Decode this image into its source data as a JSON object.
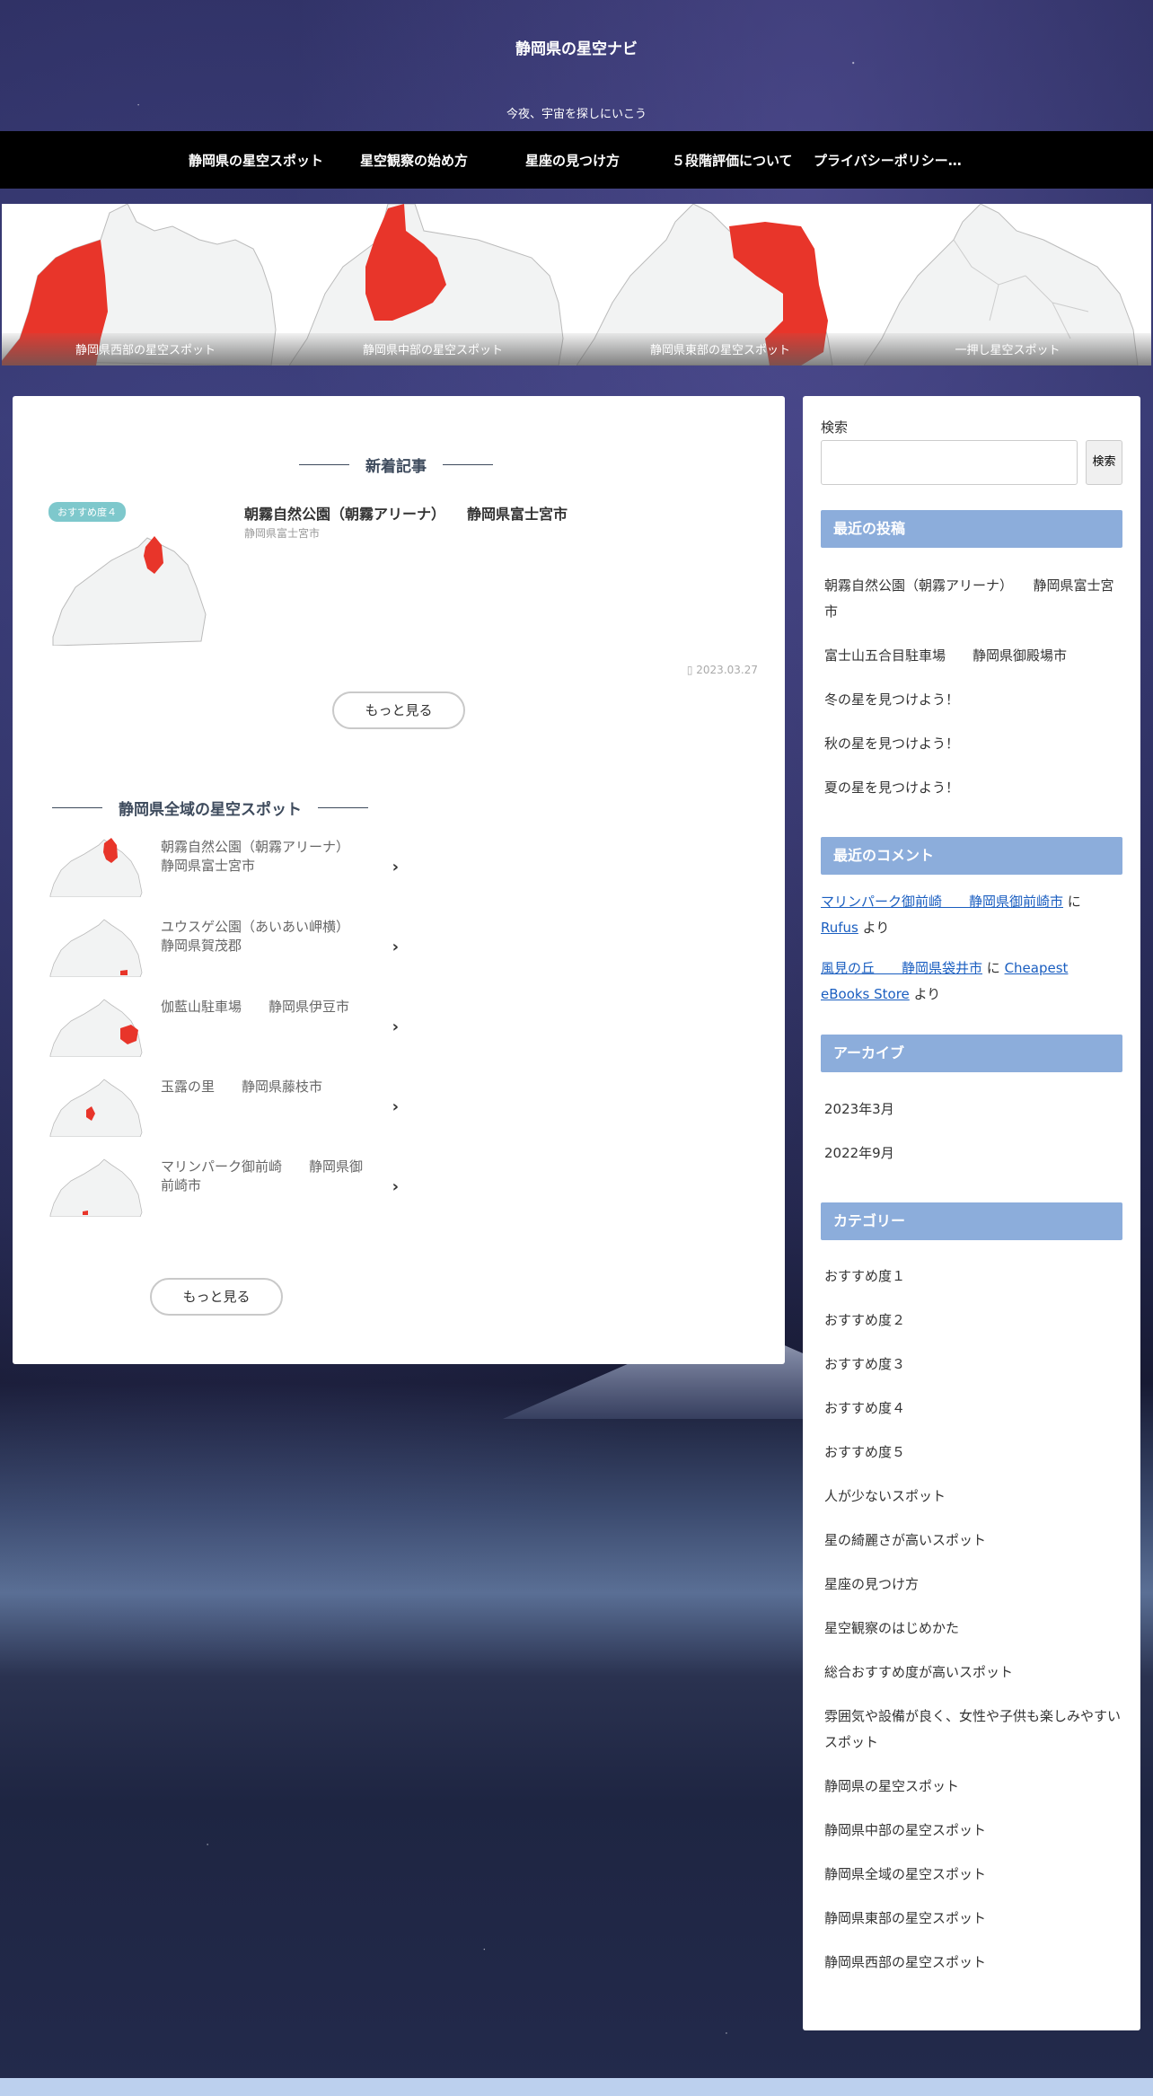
{
  "site": {
    "title": "静岡県の星空ナビ",
    "tagline": "今夜、宇宙を探しにいこう"
  },
  "nav": {
    "items": [
      "静岡県の星空スポット",
      "星空観察の始め方",
      "星座の見つけ方",
      "５段階評価について",
      "プライバシーポリシー…"
    ]
  },
  "carousel": {
    "slides": [
      {
        "caption": "静岡県西部の星空スポット",
        "region": "west"
      },
      {
        "caption": "静岡県中部の星空スポット",
        "region": "central"
      },
      {
        "caption": "静岡県東部の星空スポット",
        "region": "east"
      },
      {
        "caption": "一押し星空スポット",
        "region": "none"
      }
    ]
  },
  "colors": {
    "highlight": "#e8352a",
    "map_fill": "#f2f3f3",
    "widget_header": "#8caddb",
    "badge": "#7ec8cc",
    "link": "#1a5ec0"
  },
  "new_posts": {
    "heading": "新着記事",
    "post": {
      "badge": "おすすめ度４",
      "title": "朝霧自然公園（朝霧アリーナ）　　静岡県富士宮市",
      "category": "静岡県富士宮市",
      "date": "2023.03.27",
      "clock_icon": "clock-icon"
    },
    "more_label": "もっと見る"
  },
  "spots": {
    "heading": "静岡県全域の星空スポット",
    "items": [
      {
        "title": "朝霧自然公園（朝霧アリーナ）　　静岡県富士宮市"
      },
      {
        "title": "ユウスゲ公園（あいあい岬横）　　静岡県賀茂郡"
      },
      {
        "title": "伽藍山駐車場　　静岡県伊豆市"
      },
      {
        "title": "玉露の里　　静岡県藤枝市"
      },
      {
        "title": "マリンパーク御前崎　　静岡県御前崎市"
      }
    ],
    "more_label": "もっと見る"
  },
  "sidebar": {
    "search_label": "検索",
    "search_placeholder": "",
    "search_button": "検索",
    "recent_posts_title": "最近の投稿",
    "recent_posts": [
      "朝霧自然公園（朝霧アリーナ）　　静岡県富士宮市",
      "富士山五合目駐車場　　静岡県御殿場市",
      "冬の星を見つけよう！",
      "秋の星を見つけよう！",
      "夏の星を見つけよう！"
    ],
    "recent_comments_title": "最近のコメント",
    "recent_comments": [
      {
        "post": "マリンパーク御前崎　　静岡県御前崎市",
        "joiner": " に ",
        "author": "Rufus",
        "suffix": " より"
      },
      {
        "post": "風見の丘　　静岡県袋井市",
        "joiner": " に ",
        "author": "Cheapest eBooks Store",
        "suffix": " より"
      }
    ],
    "archive_title": "アーカイブ",
    "archives": [
      "2023年3月",
      "2022年9月"
    ],
    "category_title": "カテゴリー",
    "categories": [
      "おすすめ度１",
      "おすすめ度２",
      "おすすめ度３",
      "おすすめ度４",
      "おすすめ度５",
      "人が少ないスポット",
      "星の綺麗さが高いスポット",
      "星座の見つけ方",
      "星空観察のはじめかた",
      "総合おすすめ度が高いスポット",
      "雰囲気や設備が良く、女性や子供も楽しみやすいスポット",
      "静岡県の星空スポット",
      "静岡県中部の星空スポット",
      "静岡県全域の星空スポット",
      "静岡県東部の星空スポット",
      "静岡県西部の星空スポット"
    ]
  }
}
